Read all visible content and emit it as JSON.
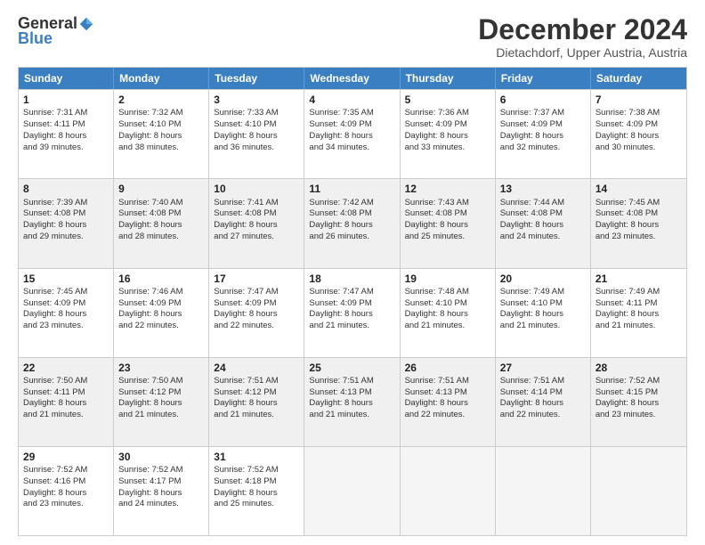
{
  "logo": {
    "general": "General",
    "blue": "Blue"
  },
  "header": {
    "month": "December 2024",
    "location": "Dietachdorf, Upper Austria, Austria"
  },
  "days": [
    "Sunday",
    "Monday",
    "Tuesday",
    "Wednesday",
    "Thursday",
    "Friday",
    "Saturday"
  ],
  "weeks": [
    [
      {
        "day": "1",
        "lines": [
          "Sunrise: 7:31 AM",
          "Sunset: 4:11 PM",
          "Daylight: 8 hours",
          "and 39 minutes."
        ]
      },
      {
        "day": "2",
        "lines": [
          "Sunrise: 7:32 AM",
          "Sunset: 4:10 PM",
          "Daylight: 8 hours",
          "and 38 minutes."
        ]
      },
      {
        "day": "3",
        "lines": [
          "Sunrise: 7:33 AM",
          "Sunset: 4:10 PM",
          "Daylight: 8 hours",
          "and 36 minutes."
        ]
      },
      {
        "day": "4",
        "lines": [
          "Sunrise: 7:35 AM",
          "Sunset: 4:09 PM",
          "Daylight: 8 hours",
          "and 34 minutes."
        ]
      },
      {
        "day": "5",
        "lines": [
          "Sunrise: 7:36 AM",
          "Sunset: 4:09 PM",
          "Daylight: 8 hours",
          "and 33 minutes."
        ]
      },
      {
        "day": "6",
        "lines": [
          "Sunrise: 7:37 AM",
          "Sunset: 4:09 PM",
          "Daylight: 8 hours",
          "and 32 minutes."
        ]
      },
      {
        "day": "7",
        "lines": [
          "Sunrise: 7:38 AM",
          "Sunset: 4:09 PM",
          "Daylight: 8 hours",
          "and 30 minutes."
        ]
      }
    ],
    [
      {
        "day": "8",
        "lines": [
          "Sunrise: 7:39 AM",
          "Sunset: 4:08 PM",
          "Daylight: 8 hours",
          "and 29 minutes."
        ]
      },
      {
        "day": "9",
        "lines": [
          "Sunrise: 7:40 AM",
          "Sunset: 4:08 PM",
          "Daylight: 8 hours",
          "and 28 minutes."
        ]
      },
      {
        "day": "10",
        "lines": [
          "Sunrise: 7:41 AM",
          "Sunset: 4:08 PM",
          "Daylight: 8 hours",
          "and 27 minutes."
        ]
      },
      {
        "day": "11",
        "lines": [
          "Sunrise: 7:42 AM",
          "Sunset: 4:08 PM",
          "Daylight: 8 hours",
          "and 26 minutes."
        ]
      },
      {
        "day": "12",
        "lines": [
          "Sunrise: 7:43 AM",
          "Sunset: 4:08 PM",
          "Daylight: 8 hours",
          "and 25 minutes."
        ]
      },
      {
        "day": "13",
        "lines": [
          "Sunrise: 7:44 AM",
          "Sunset: 4:08 PM",
          "Daylight: 8 hours",
          "and 24 minutes."
        ]
      },
      {
        "day": "14",
        "lines": [
          "Sunrise: 7:45 AM",
          "Sunset: 4:08 PM",
          "Daylight: 8 hours",
          "and 23 minutes."
        ]
      }
    ],
    [
      {
        "day": "15",
        "lines": [
          "Sunrise: 7:45 AM",
          "Sunset: 4:09 PM",
          "Daylight: 8 hours",
          "and 23 minutes."
        ]
      },
      {
        "day": "16",
        "lines": [
          "Sunrise: 7:46 AM",
          "Sunset: 4:09 PM",
          "Daylight: 8 hours",
          "and 22 minutes."
        ]
      },
      {
        "day": "17",
        "lines": [
          "Sunrise: 7:47 AM",
          "Sunset: 4:09 PM",
          "Daylight: 8 hours",
          "and 22 minutes."
        ]
      },
      {
        "day": "18",
        "lines": [
          "Sunrise: 7:47 AM",
          "Sunset: 4:09 PM",
          "Daylight: 8 hours",
          "and 21 minutes."
        ]
      },
      {
        "day": "19",
        "lines": [
          "Sunrise: 7:48 AM",
          "Sunset: 4:10 PM",
          "Daylight: 8 hours",
          "and 21 minutes."
        ]
      },
      {
        "day": "20",
        "lines": [
          "Sunrise: 7:49 AM",
          "Sunset: 4:10 PM",
          "Daylight: 8 hours",
          "and 21 minutes."
        ]
      },
      {
        "day": "21",
        "lines": [
          "Sunrise: 7:49 AM",
          "Sunset: 4:11 PM",
          "Daylight: 8 hours",
          "and 21 minutes."
        ]
      }
    ],
    [
      {
        "day": "22",
        "lines": [
          "Sunrise: 7:50 AM",
          "Sunset: 4:11 PM",
          "Daylight: 8 hours",
          "and 21 minutes."
        ]
      },
      {
        "day": "23",
        "lines": [
          "Sunrise: 7:50 AM",
          "Sunset: 4:12 PM",
          "Daylight: 8 hours",
          "and 21 minutes."
        ]
      },
      {
        "day": "24",
        "lines": [
          "Sunrise: 7:51 AM",
          "Sunset: 4:12 PM",
          "Daylight: 8 hours",
          "and 21 minutes."
        ]
      },
      {
        "day": "25",
        "lines": [
          "Sunrise: 7:51 AM",
          "Sunset: 4:13 PM",
          "Daylight: 8 hours",
          "and 21 minutes."
        ]
      },
      {
        "day": "26",
        "lines": [
          "Sunrise: 7:51 AM",
          "Sunset: 4:13 PM",
          "Daylight: 8 hours",
          "and 22 minutes."
        ]
      },
      {
        "day": "27",
        "lines": [
          "Sunrise: 7:51 AM",
          "Sunset: 4:14 PM",
          "Daylight: 8 hours",
          "and 22 minutes."
        ]
      },
      {
        "day": "28",
        "lines": [
          "Sunrise: 7:52 AM",
          "Sunset: 4:15 PM",
          "Daylight: 8 hours",
          "and 23 minutes."
        ]
      }
    ],
    [
      {
        "day": "29",
        "lines": [
          "Sunrise: 7:52 AM",
          "Sunset: 4:16 PM",
          "Daylight: 8 hours",
          "and 23 minutes."
        ]
      },
      {
        "day": "30",
        "lines": [
          "Sunrise: 7:52 AM",
          "Sunset: 4:17 PM",
          "Daylight: 8 hours",
          "and 24 minutes."
        ]
      },
      {
        "day": "31",
        "lines": [
          "Sunrise: 7:52 AM",
          "Sunset: 4:18 PM",
          "Daylight: 8 hours",
          "and 25 minutes."
        ]
      },
      null,
      null,
      null,
      null
    ]
  ]
}
